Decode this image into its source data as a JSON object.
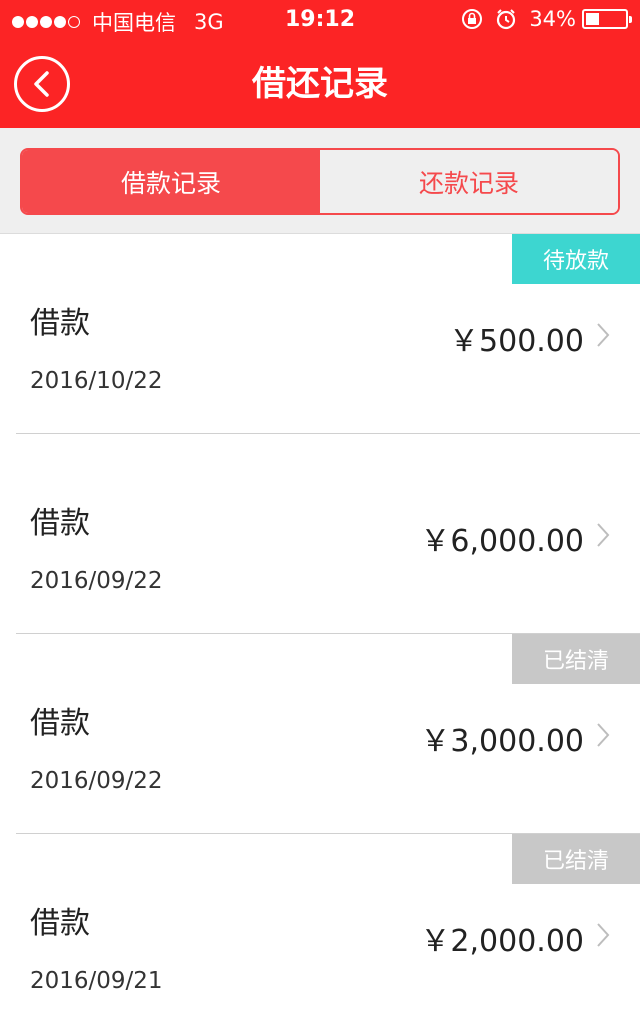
{
  "status_bar": {
    "carrier": "中国电信",
    "network": "3G",
    "time": "19:12",
    "battery": "34%",
    "battery_level": 0.34,
    "signal_bars_filled": 4,
    "signal_bars_total": 5
  },
  "nav": {
    "title": "借还记录"
  },
  "tabs": [
    {
      "label": "借款记录",
      "active": true
    },
    {
      "label": "还款记录",
      "active": false
    }
  ],
  "records": [
    {
      "type": "借款",
      "date": "2016/10/22",
      "amount": "￥500.00",
      "badge": "待放款"
    },
    {
      "type": "借款",
      "date": "2016/09/22",
      "amount": "￥6,000.00",
      "badge": ""
    },
    {
      "type": "借款",
      "date": "2016/09/22",
      "amount": "￥3,000.00",
      "badge": "已结清"
    },
    {
      "type": "借款",
      "date": "2016/09/21",
      "amount": "￥2,000.00",
      "badge": "已结清"
    }
  ],
  "colors": {
    "header_red": "#fc2425",
    "tab_red": "#f5494c",
    "badge_pending": "#3dd6d0",
    "badge_settled": "#c8c8c8"
  }
}
